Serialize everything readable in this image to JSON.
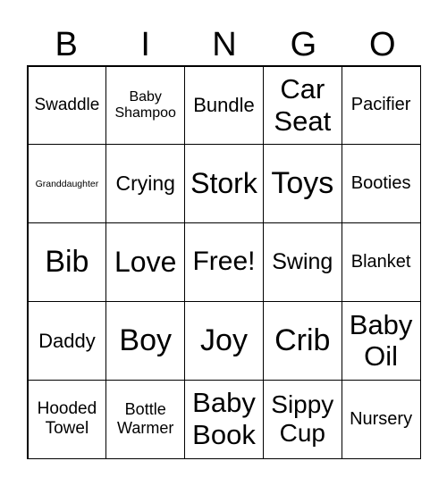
{
  "header": [
    "B",
    "I",
    "N",
    "G",
    "O"
  ],
  "cells": [
    "Swaddle",
    "Baby Shampoo",
    "Bundle",
    "Car Seat",
    "Pacifier",
    "Granddaughter",
    "Crying",
    "Stork",
    "Toys",
    "Booties",
    "Bib",
    "Love",
    "Free!",
    "Swing",
    "Blanket",
    "Daddy",
    "Boy",
    "Joy",
    "Crib",
    "Baby Oil",
    "Hooded Towel",
    "Bottle Warmer",
    "Baby Book",
    "Sippy Cup",
    "Nursery"
  ]
}
